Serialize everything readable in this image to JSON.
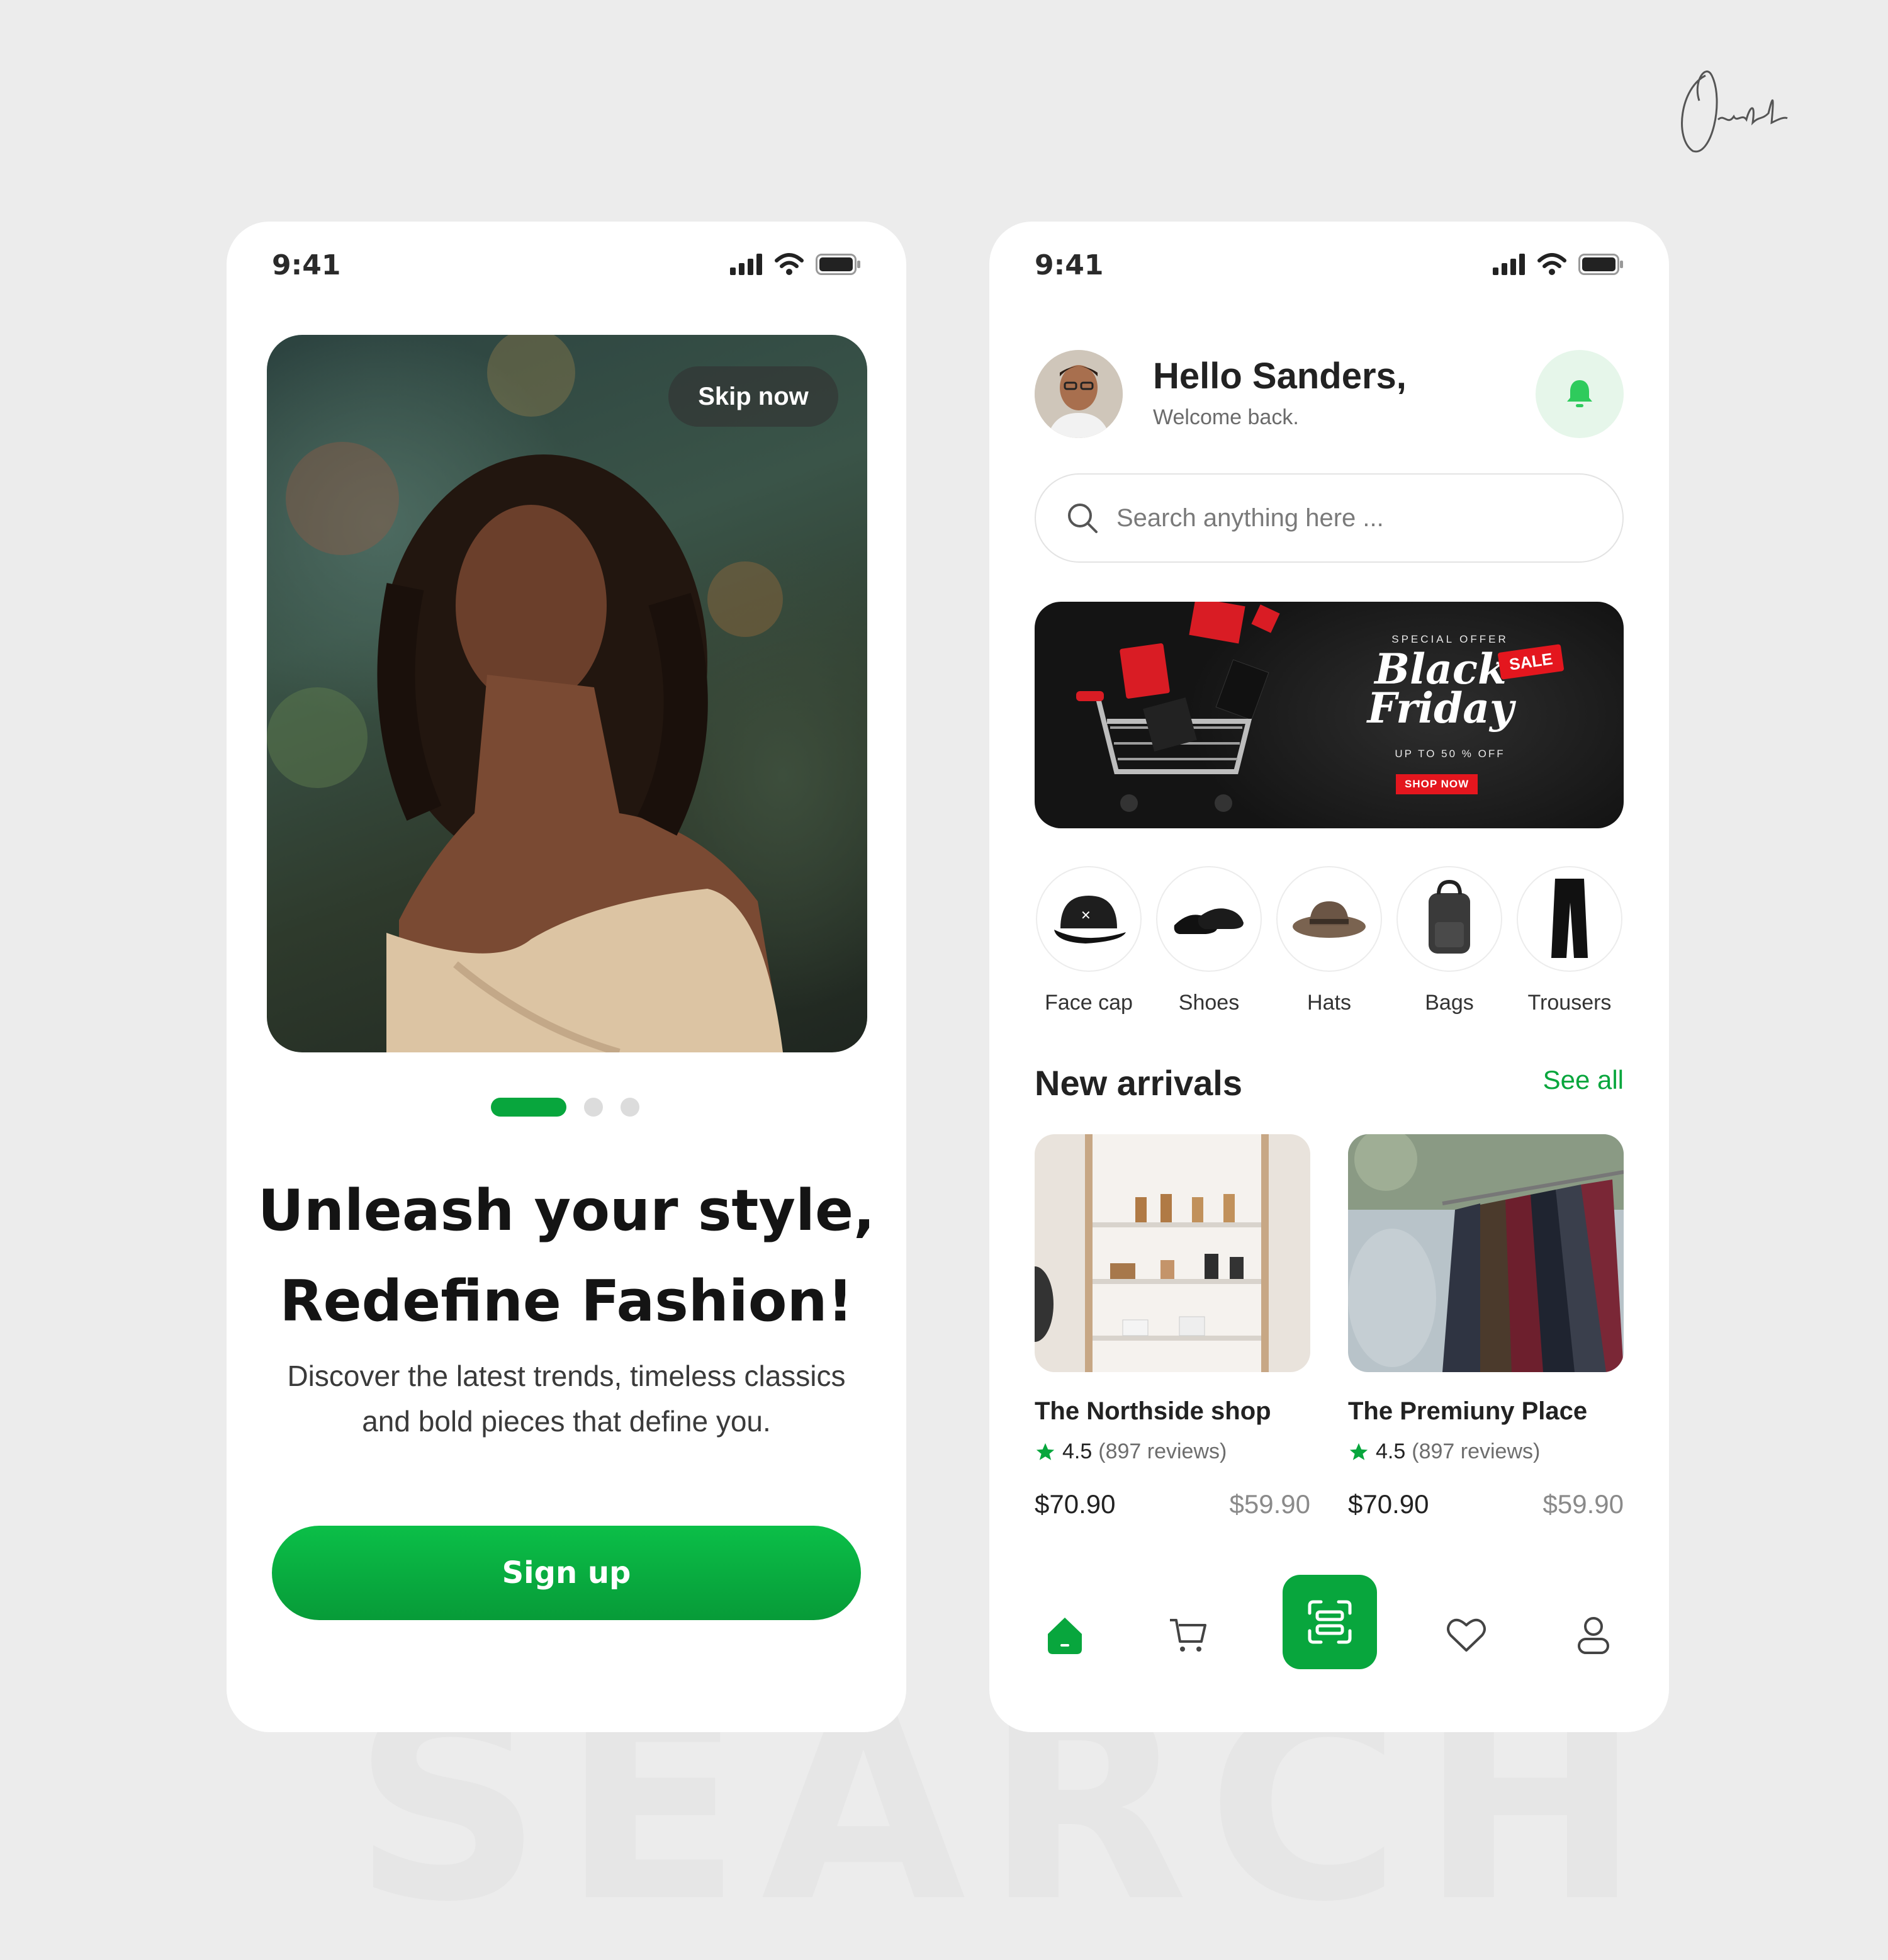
{
  "brand": {
    "accent": "#08A63D",
    "signature": "Orakle",
    "background_word": "SEARCH"
  },
  "left_screen": {
    "status": {
      "time": "9:41"
    },
    "hero": {
      "skip_label": "Skip now",
      "image": "woman-with-curly-hair-portrait"
    },
    "pager": {
      "count": 3,
      "active": 0
    },
    "headline_line1": "Unleash your style,",
    "headline_line2": "Redefine Fashion!",
    "subtext_line1": "Discover the latest trends, timeless classics",
    "subtext_line2": "and bold pieces that define you.",
    "cta_label": "Sign up"
  },
  "right_screen": {
    "status": {
      "time": "9:41"
    },
    "header": {
      "greeting": "Hello Sanders,",
      "welcome": "Welcome back."
    },
    "search": {
      "placeholder": "Search anything here ..."
    },
    "banner": {
      "special": "SPECIAL OFFER",
      "title_line1": "Black",
      "title_line2": "Friday",
      "sale_tag": "SALE",
      "discount": "UP TO 50 % OFF",
      "cta": "SHOP NOW"
    },
    "categories": [
      {
        "label": "Face cap",
        "icon": "cap-icon"
      },
      {
        "label": "Shoes",
        "icon": "shoes-icon"
      },
      {
        "label": "Hats",
        "icon": "hat-icon"
      },
      {
        "label": "Bags",
        "icon": "bag-icon"
      },
      {
        "label": "Trousers",
        "icon": "trousers-icon"
      }
    ],
    "new_arrivals": {
      "title": "New arrivals",
      "see_all": "See all",
      "items": [
        {
          "name": "The Northside shop",
          "rating": "4.5",
          "reviews": "(897 reviews)",
          "price": "$70.90",
          "old_price": "$59.90"
        },
        {
          "name": "The Premiuny Place",
          "rating": "4.5",
          "reviews": "(897 reviews)",
          "price": "$70.90",
          "old_price": "$59.90"
        }
      ]
    },
    "tabbar": {
      "items": [
        "home-icon",
        "cart-icon",
        "scan-icon",
        "heart-icon",
        "profile-icon"
      ],
      "active": "home-icon"
    }
  }
}
